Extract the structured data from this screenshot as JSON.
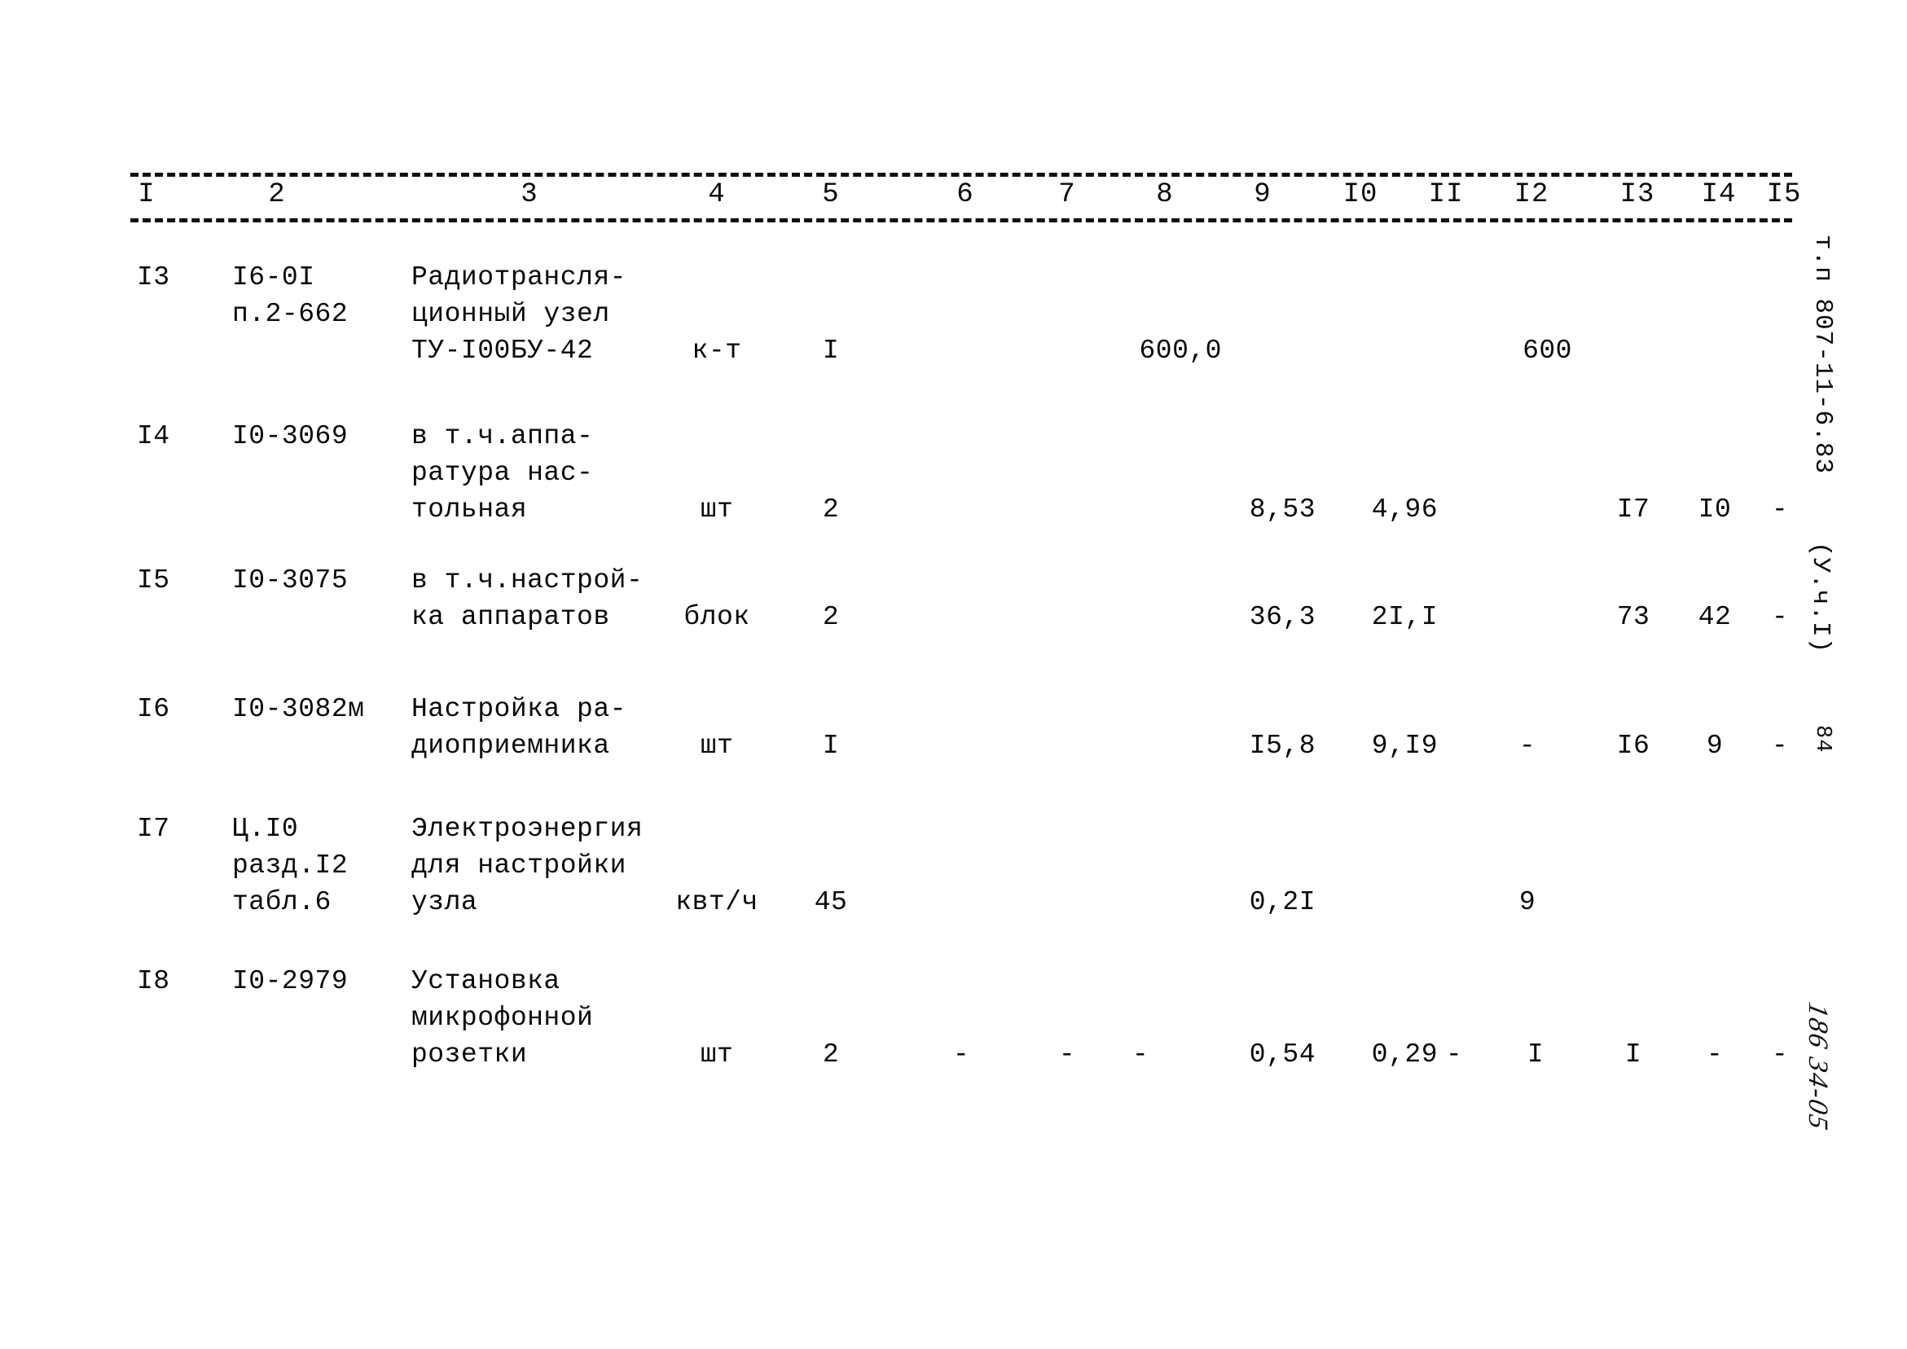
{
  "document": {
    "type": "estimate-table",
    "column_headers": [
      "I",
      "2",
      "3",
      "4",
      "5",
      "6",
      "7",
      "8",
      "9",
      "I0",
      "II",
      "I2",
      "I3",
      "I4",
      "I5"
    ],
    "margin_stamp_top": "т.п 807-11-6.83",
    "margin_stamp_mid": "(У.ч.I)",
    "page_number": "84",
    "margin_handwritten": "186 34-05"
  },
  "rows": [
    {
      "c1": "I3",
      "c2": [
        "I6-0I",
        "п.2-662"
      ],
      "c3": [
        "Радиотрансля-",
        "ционный узел",
        "ТУ-I00БУ-42"
      ],
      "c4": "к-т",
      "c5": "I",
      "c6": "",
      "c7": "",
      "c8": "600,0",
      "c9": "",
      "c10": "",
      "c11": "",
      "c12": "600",
      "c13": "",
      "c14": "",
      "c15": ""
    },
    {
      "c1": "I4",
      "c2": [
        "I0-3069"
      ],
      "c3": [
        "в т.ч.аппа-",
        "ратура нас-",
        "тольная"
      ],
      "c4": "шт",
      "c5": "2",
      "c6": "",
      "c7": "",
      "c8": "",
      "c9": "8,53",
      "c10": "4,96",
      "c11": "",
      "c12": "",
      "c13": "I7",
      "c14": "I0",
      "c15": "-"
    },
    {
      "c1": "I5",
      "c2": [
        "I0-3075"
      ],
      "c3": [
        "в т.ч.настрой-",
        "ка аппаратов"
      ],
      "c4": "блок",
      "c5": "2",
      "c6": "",
      "c7": "",
      "c8": "",
      "c9": "36,3",
      "c10": "2I,I",
      "c11": "",
      "c12": "",
      "c13": "73",
      "c14": "42",
      "c15": "-"
    },
    {
      "c1": "I6",
      "c2": [
        "I0-3082м"
      ],
      "c3": [
        "Настройка ра-",
        "диоприемника"
      ],
      "c4": "шт",
      "c5": "I",
      "c6": "",
      "c7": "",
      "c8": "",
      "c9": "I5,8",
      "c10": "9,I9",
      "c11": "",
      "c12": "-",
      "c13": "I6",
      "c14": "9",
      "c15": "-"
    },
    {
      "c1": "I7",
      "c2": [
        "Ц.I0",
        "разд.I2",
        "табл.6"
      ],
      "c3": [
        "Электроэнергия",
        "для настройки",
        "узла"
      ],
      "c4": "квт/ч",
      "c5": "45",
      "c6": "",
      "c7": "",
      "c8": "",
      "c9": "0,2I",
      "c10": "",
      "c11": "",
      "c12": "9",
      "c13": "",
      "c14": "",
      "c15": ""
    },
    {
      "c1": "I8",
      "c2": [
        "I0-2979"
      ],
      "c3": [
        "Установка",
        "микрофонной",
        "розетки"
      ],
      "c4": "шт",
      "c5": "2",
      "c6": "-",
      "c7": "-",
      "c8": "-",
      "c9": "0,54",
      "c10": "0,29",
      "c11": "-",
      "c12": "I",
      "c13": "I",
      "c14": "-",
      "c15": "-"
    }
  ]
}
